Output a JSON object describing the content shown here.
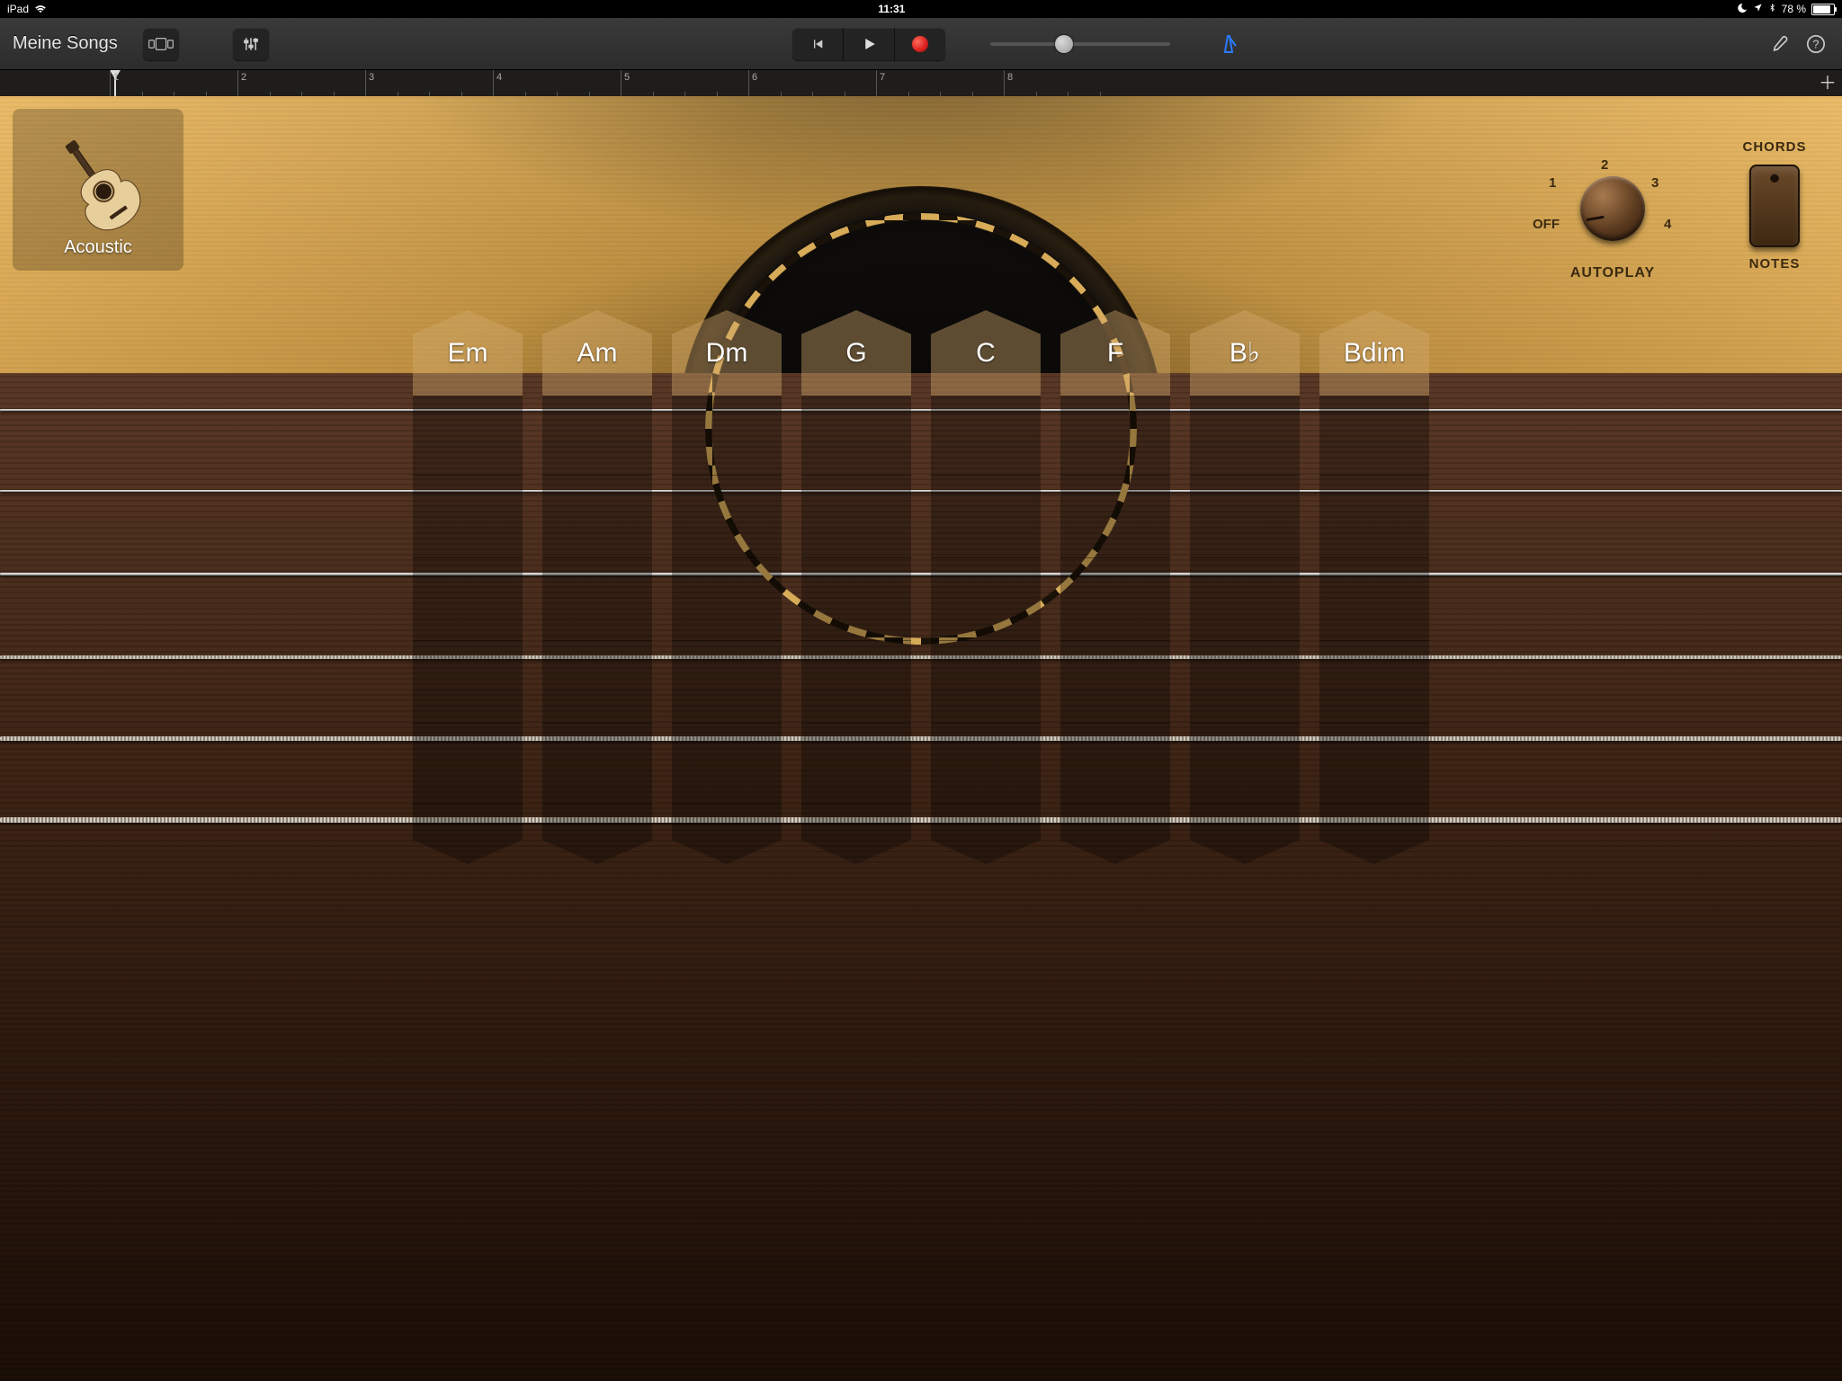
{
  "status": {
    "device": "iPad",
    "time": "11:31",
    "battery_pct": "78 %"
  },
  "toolbar": {
    "my_songs": "Meine Songs"
  },
  "ruler": {
    "bars": [
      "1",
      "2",
      "3",
      "4",
      "5",
      "6",
      "7",
      "8"
    ]
  },
  "instrument": {
    "name": "Acoustic"
  },
  "autoplay": {
    "label": "AUTOPLAY",
    "positions": {
      "off": "OFF",
      "p1": "1",
      "p2": "2",
      "p3": "3",
      "p4": "4"
    },
    "current": "OFF"
  },
  "mode_switch": {
    "top": "CHORDS",
    "bottom": "NOTES",
    "current": "CHORDS"
  },
  "chords": [
    "Em",
    "Am",
    "Dm",
    "G",
    "C",
    "F",
    "B♭",
    "Bdim"
  ]
}
